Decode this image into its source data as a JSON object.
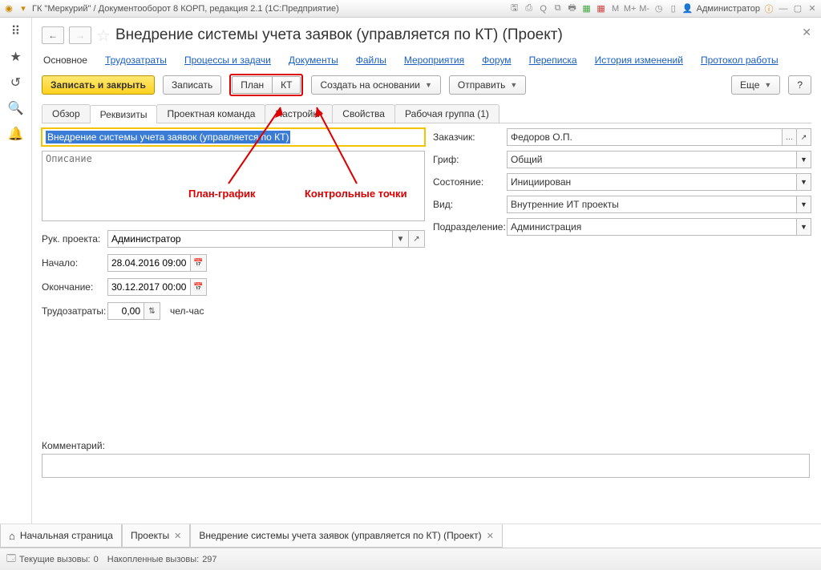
{
  "titlebar": {
    "text": "ГК \"Меркурий\" / Документооборот 8 КОРП, редакция 2.1  (1С:Предприятие)",
    "user": "Администратор"
  },
  "header": {
    "title": "Внедрение системы учета заявок (управляется по КТ) (Проект)"
  },
  "links": [
    "Основное",
    "Трудозатраты",
    "Процессы и задачи",
    "Документы",
    "Файлы",
    "Мероприятия",
    "Форум",
    "Переписка",
    "История изменений",
    "Протокол работы"
  ],
  "toolbar": {
    "save_close": "Записать и закрыть",
    "save": "Записать",
    "plan": "План",
    "kt": "КТ",
    "create_based": "Создать на основании",
    "send": "Отправить",
    "more": "Еще",
    "help": "?"
  },
  "annotations": {
    "plan": "План-график",
    "kt": "Контрольные точки"
  },
  "tabs": [
    "Обзор",
    "Реквизиты",
    "Проектная команда",
    "Настройки",
    "Свойства",
    "Рабочая группа (1)"
  ],
  "fields": {
    "name_value": "Внедрение системы учета заявок (управляется по КТ)",
    "desc_placeholder": "Описание",
    "manager_label": "Рук. проекта:",
    "manager_value": "Администратор",
    "start_label": "Начало:",
    "start_value": "28.04.2016 09:00",
    "end_label": "Окончание:",
    "end_value": "30.12.2017 00:00",
    "effort_label": "Трудозатраты:",
    "effort_value": "0,00",
    "effort_unit": "чел-час",
    "customer_label": "Заказчик:",
    "customer_value": "Федоров О.П.",
    "stamp_label": "Гриф:",
    "stamp_value": "Общий",
    "state_label": "Состояние:",
    "state_value": "Инициирован",
    "type_label": "Вид:",
    "type_value": "Внутренние ИТ проекты",
    "dept_label": "Подразделение:",
    "dept_value": "Администрация",
    "comment_label": "Комментарий:"
  },
  "bottom_tabs": {
    "home": "Начальная страница",
    "projects": "Проекты",
    "current": "Внедрение системы учета заявок (управляется по КТ) (Проект)"
  },
  "status": {
    "calls_label": "Текущие вызовы:",
    "calls_value": "0",
    "accum_label": "Накопленные вызовы:",
    "accum_value": "297"
  }
}
